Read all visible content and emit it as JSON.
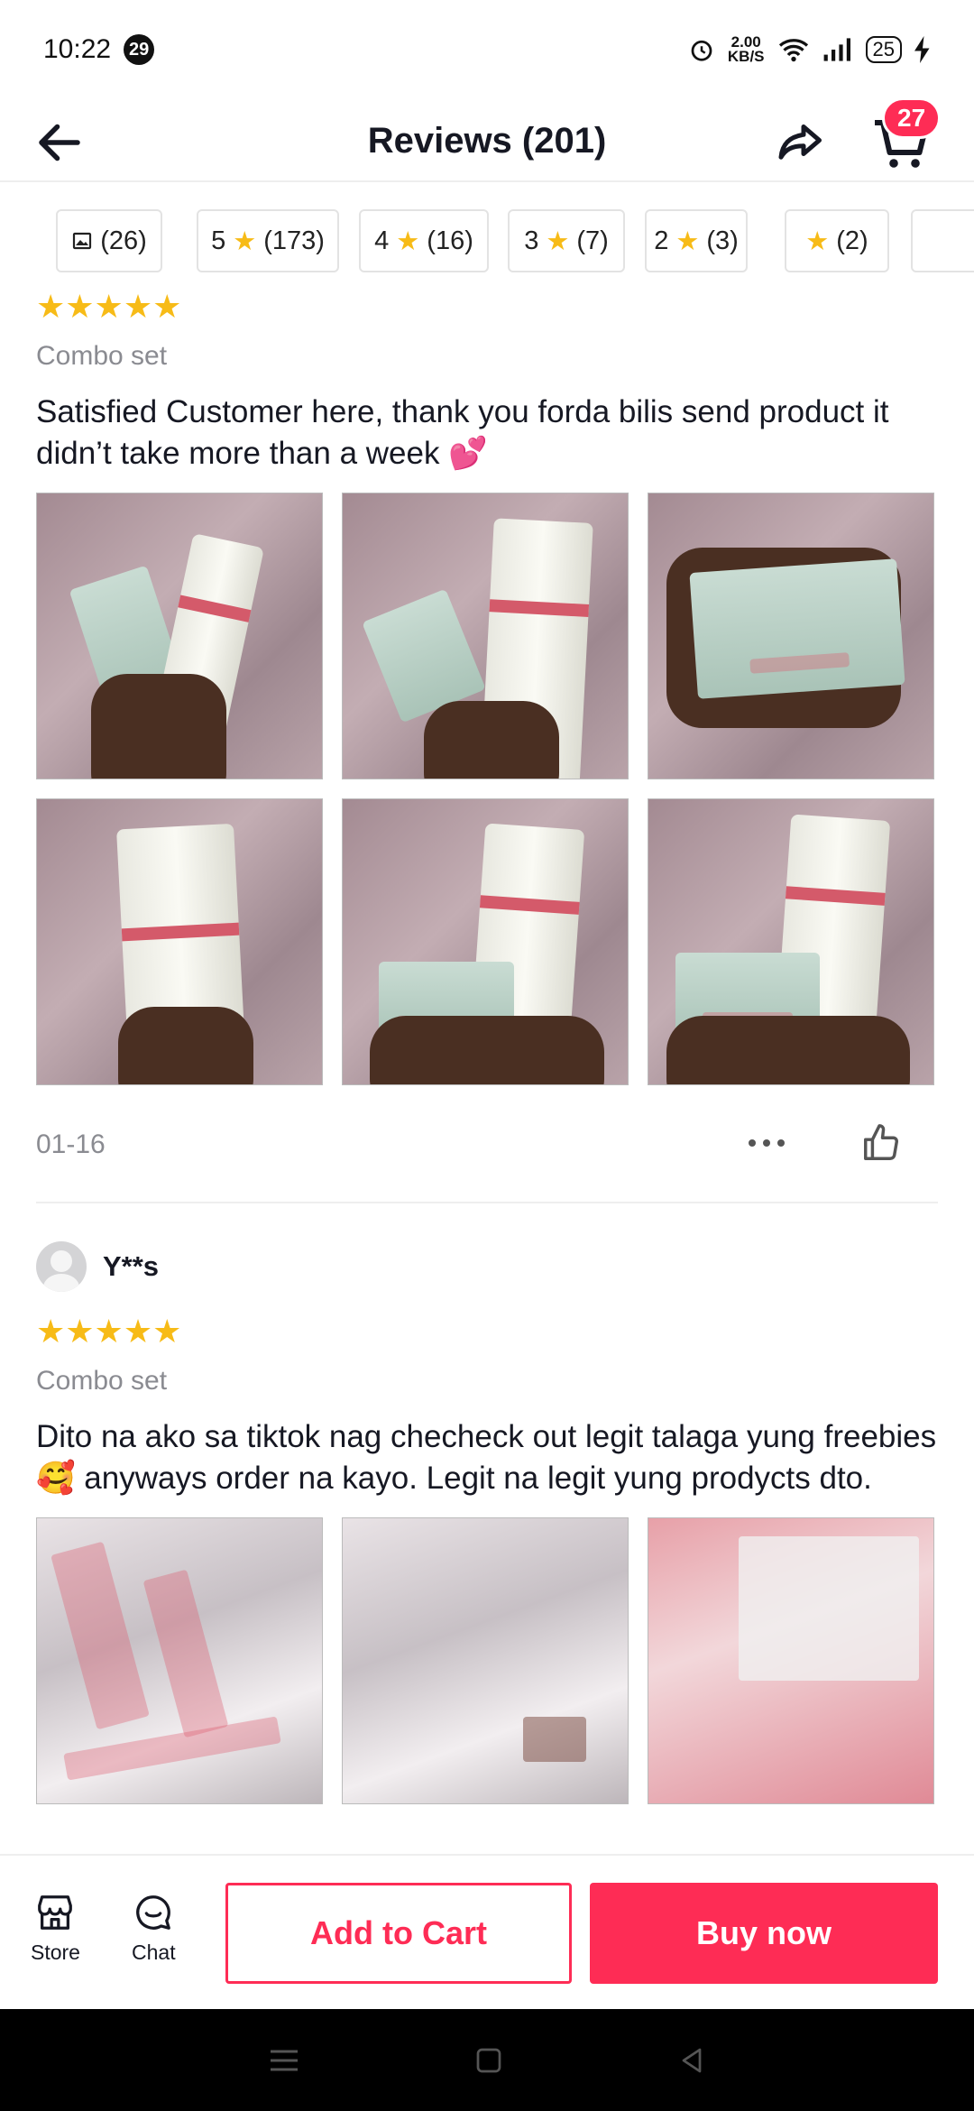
{
  "status_bar": {
    "time": "10:22",
    "notif_count": "29",
    "net_speed_value": "2.00",
    "net_speed_unit": "KB/S",
    "battery": "25"
  },
  "header": {
    "title": "Reviews (201)",
    "cart_count": "27"
  },
  "filters": [
    {
      "icon": "image-icon",
      "label": "(26)"
    },
    {
      "rating": "5",
      "label": "(173)"
    },
    {
      "rating": "4",
      "label": "(16)"
    },
    {
      "rating": "3",
      "label": "(7)"
    },
    {
      "rating": "2",
      "label": "(3)"
    },
    {
      "rating": "",
      "label": "(2)"
    }
  ],
  "reviews": [
    {
      "stars": 5,
      "variant": "Combo set",
      "text": "Satisfied Customer here, thank you forda bilis send product it didn’t take more than a week 💕",
      "photo_count": 6,
      "date": "01-16"
    },
    {
      "user": "Y**s",
      "stars": 5,
      "variant": "Combo set",
      "text": "Dito na ako sa tiktok nag checheck out legit talaga yung freebies🥰 anyways  order na kayo. Legit na legit yung prodycts dto.",
      "photo_count": 3
    }
  ],
  "bottom_bar": {
    "store_label": "Store",
    "chat_label": "Chat",
    "add_to_cart": "Add to Cart",
    "buy_now": "Buy now"
  },
  "colors": {
    "accent": "#fe2c55",
    "star": "#f7bb17"
  }
}
